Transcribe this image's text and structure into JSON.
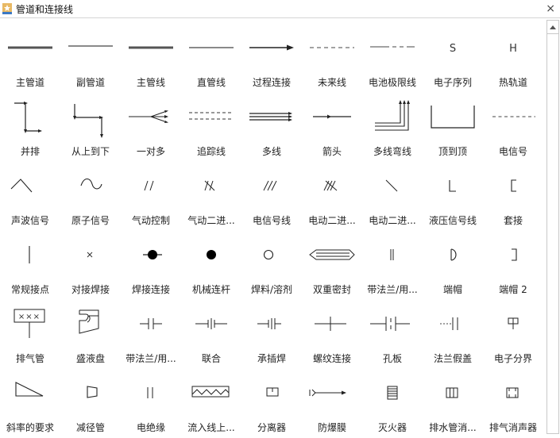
{
  "window": {
    "title": "管道和连接线",
    "close_label": "×"
  },
  "rows": [
    [
      {
        "label": "主管道",
        "icon": "main-pipe-icon"
      },
      {
        "label": "副管道",
        "icon": "secondary-pipe-icon"
      },
      {
        "label": "主管线",
        "icon": "main-line-icon"
      },
      {
        "label": "直管线",
        "icon": "straight-line-icon"
      },
      {
        "label": "过程连接",
        "icon": "process-connection-icon"
      },
      {
        "label": "未来线",
        "icon": "future-line-icon"
      },
      {
        "label": "电池极限线",
        "icon": "battery-limit-icon"
      },
      {
        "label": "电子序列",
        "icon": "electronic-series-icon",
        "glyph": "S"
      },
      {
        "label": "热轨道",
        "icon": "heat-trace-icon",
        "glyph": "H"
      }
    ],
    [
      {
        "label": "并排",
        "icon": "side-by-side-icon"
      },
      {
        "label": "从上到下",
        "icon": "top-to-bottom-icon"
      },
      {
        "label": "一对多",
        "icon": "one-to-many-icon"
      },
      {
        "label": "追踪线",
        "icon": "trace-line-icon"
      },
      {
        "label": "多线",
        "icon": "multi-line-icon"
      },
      {
        "label": "箭头",
        "icon": "arrow-icon"
      },
      {
        "label": "多线弯线",
        "icon": "multi-line-bend-icon"
      },
      {
        "label": "顶到顶",
        "icon": "top-to-top-icon"
      },
      {
        "label": "电信号",
        "icon": "electric-signal-icon"
      }
    ],
    [
      {
        "label": "声波信号",
        "icon": "sonic-signal-icon"
      },
      {
        "label": "原子信号",
        "icon": "nuclear-signal-icon"
      },
      {
        "label": "气动控制",
        "icon": "pneumatic-control-icon"
      },
      {
        "label": "气动二进...",
        "icon": "pneumatic-binary-icon"
      },
      {
        "label": "电信号线",
        "icon": "electric-signal-line-icon"
      },
      {
        "label": "电动二进...",
        "icon": "electric-binary-icon"
      },
      {
        "label": "电动二进...",
        "icon": "electric-binary-2-icon"
      },
      {
        "label": "液压信号线",
        "icon": "hydraulic-signal-icon"
      },
      {
        "label": "套接",
        "icon": "socket-icon"
      }
    ],
    [
      {
        "label": "常规接点",
        "icon": "normal-junction-icon"
      },
      {
        "label": "对接焊接",
        "icon": "butt-weld-icon",
        "glyph": "×"
      },
      {
        "label": "焊接连接",
        "icon": "welded-connection-icon"
      },
      {
        "label": "机械连杆",
        "icon": "mechanical-link-icon"
      },
      {
        "label": "焊料/溶剂",
        "icon": "solder-solvent-icon"
      },
      {
        "label": "双重密封",
        "icon": "double-containment-icon"
      },
      {
        "label": "带法兰/用...",
        "icon": "flanged-bolted-icon"
      },
      {
        "label": "端帽",
        "icon": "end-cap-icon"
      },
      {
        "label": "端帽 2",
        "icon": "end-cap-2-icon"
      }
    ],
    [
      {
        "label": "排气管",
        "icon": "vent-pipe-icon",
        "glyph": "×××"
      },
      {
        "label": "盛液盘",
        "icon": "drip-pan-icon"
      },
      {
        "label": "带法兰/用...",
        "icon": "flange-bolted-2-icon"
      },
      {
        "label": "联合",
        "icon": "union-icon"
      },
      {
        "label": "承插焊",
        "icon": "socket-weld-icon"
      },
      {
        "label": "螺纹连接",
        "icon": "screwed-connection-icon"
      },
      {
        "label": "孔板",
        "icon": "orifice-plate-icon"
      },
      {
        "label": "法兰假盖",
        "icon": "blind-flange-icon"
      },
      {
        "label": "电子分界",
        "icon": "electronic-boundary-icon"
      }
    ],
    [
      {
        "label": "斜率的要求",
        "icon": "slope-requirement-icon"
      },
      {
        "label": "减径管",
        "icon": "reducer-icon"
      },
      {
        "label": "电绝缘",
        "icon": "electrical-insulation-icon"
      },
      {
        "label": "流入线上...",
        "icon": "inline-flow-icon"
      },
      {
        "label": "分离器",
        "icon": "separator-icon"
      },
      {
        "label": "防爆膜",
        "icon": "rupture-disc-icon"
      },
      {
        "label": "灭火器",
        "icon": "flame-arrestor-icon"
      },
      {
        "label": "排水管消...",
        "icon": "drain-silencer-icon"
      },
      {
        "label": "排气消声器",
        "icon": "exhaust-silencer-icon"
      }
    ]
  ]
}
